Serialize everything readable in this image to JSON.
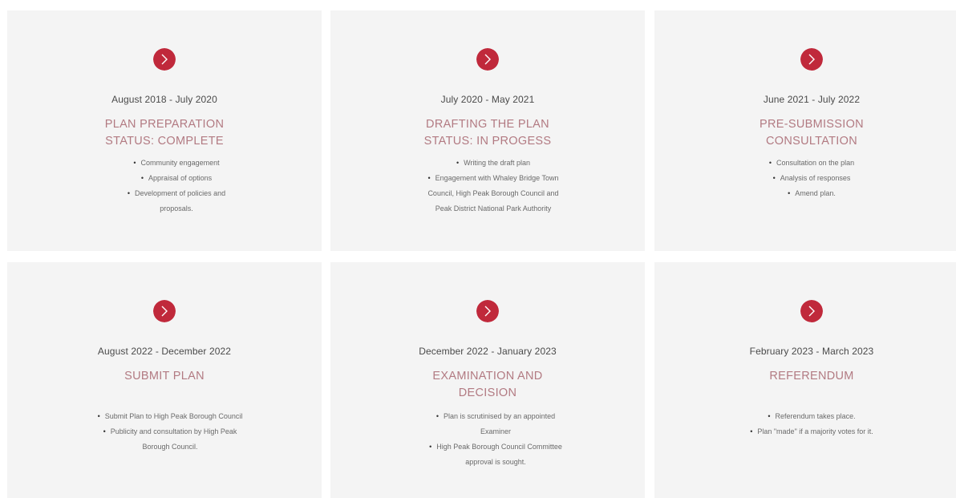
{
  "theme": {
    "accent": "#c0293b",
    "title_color": "#b27a82",
    "card_bg": "#f4f4f4"
  },
  "icon": "chevron-right-icon",
  "stages": [
    {
      "date": "August 2018 - July 2020",
      "title": "PLAN PREPARATION STATUS: COMPLETE",
      "items": [
        "Community engagement",
        "Appraisal of options",
        "Development of policies and proposals."
      ]
    },
    {
      "date": "July 2020 - May 2021",
      "title": "DRAFTING THE PLAN STATUS: IN PROGESS",
      "items": [
        "Writing the draft plan",
        "Engagement with Whaley Bridge Town Council, High Peak Borough Council and Peak District National Park Authority"
      ]
    },
    {
      "date": "June 2021 - July 2022",
      "title": "PRE-SUBMISSION CONSULTATION",
      "items": [
        "Consultation on the plan",
        "Analysis of responses",
        "Amend plan."
      ]
    },
    {
      "date": "August 2022 - December 2022",
      "title": "SUBMIT PLAN",
      "items": [
        "Submit Plan to High Peak Borough Council",
        "Publicity and consultation by High Peak Borough Council."
      ]
    },
    {
      "date": "December 2022 - January 2023",
      "title": "EXAMINATION AND DECISION",
      "items": [
        "Plan is scrutinised by an appointed Examiner",
        "High Peak Borough Council Committee approval is sought."
      ]
    },
    {
      "date": "February 2023 - March 2023",
      "title": "REFERENDUM",
      "items": [
        "Referendum takes place.",
        "Plan \"made\" if a majority votes for it."
      ]
    }
  ]
}
